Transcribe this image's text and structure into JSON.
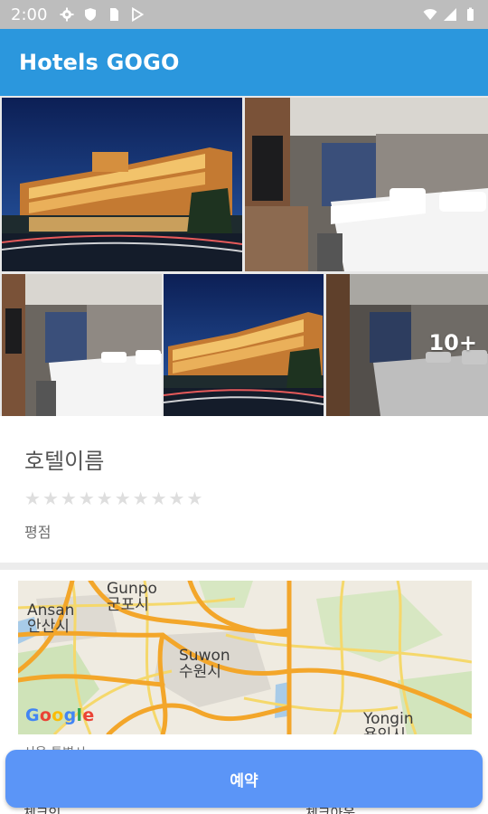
{
  "status_bar": {
    "time": "2:00",
    "icons": [
      "settings-icon",
      "shield-icon",
      "sim-card-icon",
      "play-store-icon",
      "wifi-icon",
      "signal-icon",
      "battery-icon"
    ]
  },
  "app_bar": {
    "title": "Hotels GOGO",
    "color": "#2b97dd"
  },
  "gallery": {
    "tiles": [
      "hotel-exterior-photo",
      "hotel-room-photo",
      "hotel-room-photo",
      "hotel-exterior-photo",
      "hotel-room-photo"
    ],
    "more_label": "10+"
  },
  "hotel": {
    "name": "호텔이름",
    "rating_label": "평점",
    "stars_filled": 0,
    "stars_total": 10
  },
  "map": {
    "labels": {
      "gunpo_en": "Gunpo",
      "gunpo_ko": "군포시",
      "ansan_en": "Ansan",
      "ansan_ko": "안산시",
      "suwon_en": "Suwon",
      "suwon_ko": "수원시",
      "yongin_en": "Yongin",
      "yongin_ko": "용인시"
    },
    "attribution": "Google"
  },
  "details": {
    "address": "서울 특별시",
    "check_in": "체크인",
    "check_out": "체크아웃"
  },
  "reserve_button": {
    "label": "예약",
    "color": "#5b95f7"
  }
}
